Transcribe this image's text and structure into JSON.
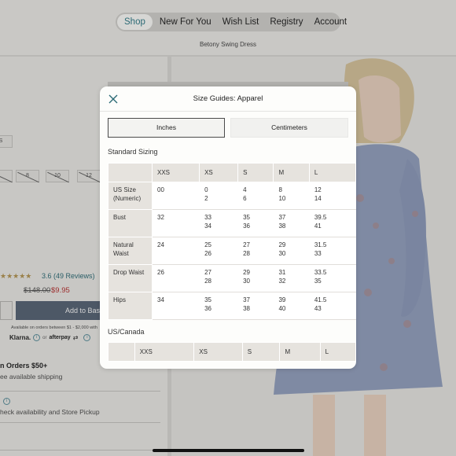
{
  "nav": {
    "items": [
      "Shop",
      "New For You",
      "Wish List",
      "Registry",
      "Account"
    ],
    "active": "Shop"
  },
  "product": {
    "name": "Betony Swing Dress",
    "size_chips": [
      "S",
      "",
      "8",
      "10",
      "12"
    ],
    "stars": "★★★★★",
    "rating": "3.6",
    "reviews": "(49 Reviews)",
    "price_original": "$148.00",
    "price_sale": "$9.95",
    "add_to_bag": "Add to Bas",
    "klarna_note": "Available on orders between $1 - $2,000 with",
    "klarna": "Klarna.",
    "or": "or",
    "afterpay": "afterpay",
    "free_shipping": "n Orders $50+",
    "free_shipping_sub": "ee available shipping",
    "store_pickup": "heck availability and Store Pickup"
  },
  "modal": {
    "title": "Size Guides: Apparel",
    "tabs": [
      "Inches",
      "Centimeters"
    ],
    "active_tab": "Inches",
    "sections": [
      {
        "title": "Standard Sizing",
        "columns": [
          "XXS",
          "XS",
          "S",
          "M",
          "L"
        ],
        "rows": [
          {
            "label": "US Size (Numeric)",
            "cells": [
              [
                "00"
              ],
              [
                "0",
                "2"
              ],
              [
                "4",
                "6"
              ],
              [
                "8",
                "10"
              ],
              [
                "12",
                "14"
              ]
            ]
          },
          {
            "label": "Bust",
            "cells": [
              [
                "32"
              ],
              [
                "33",
                "34"
              ],
              [
                "35",
                "36"
              ],
              [
                "37",
                "38"
              ],
              [
                "39.5",
                "41"
              ]
            ]
          },
          {
            "label": "Natural Waist",
            "cells": [
              [
                "24"
              ],
              [
                "25",
                "26"
              ],
              [
                "27",
                "28"
              ],
              [
                "29",
                "30"
              ],
              [
                "31.5",
                "33"
              ]
            ]
          },
          {
            "label": "Drop Waist",
            "cells": [
              [
                "26"
              ],
              [
                "27",
                "28"
              ],
              [
                "29",
                "30"
              ],
              [
                "31",
                "32"
              ],
              [
                "33.5",
                "35"
              ]
            ]
          },
          {
            "label": "Hips",
            "cells": [
              [
                "34"
              ],
              [
                "35",
                "36"
              ],
              [
                "37",
                "38"
              ],
              [
                "39",
                "40"
              ],
              [
                "41.5",
                "43"
              ]
            ]
          }
        ]
      },
      {
        "title": "US/Canada",
        "columns": [
          "XXS",
          "XS",
          "S",
          "M",
          "L"
        ]
      }
    ]
  },
  "colors": {
    "accent": "#2b6a75",
    "sale_price": "#9c2c2c",
    "add_button": "#4d5866",
    "table_header": "#e6e3de"
  }
}
